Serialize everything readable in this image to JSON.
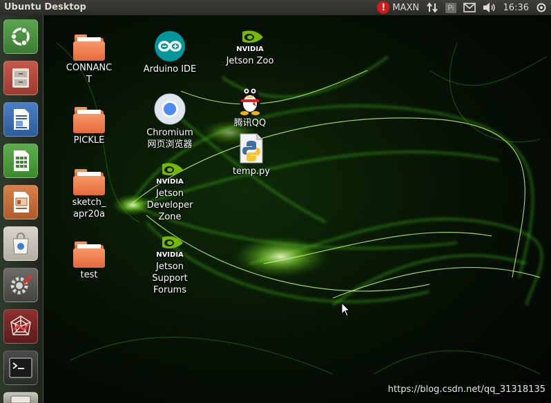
{
  "panel": {
    "title": "Ubuntu Desktop",
    "power_mode": "MAXN",
    "pi_label": "Pi",
    "clock": "16:36"
  },
  "launcher": {
    "items": [
      {
        "name": "dash-home",
        "icon": "ubuntu-logo-icon"
      },
      {
        "name": "files",
        "icon": "file-cabinet-icon"
      },
      {
        "name": "libreoffice-writer",
        "icon": "writer-doc-icon"
      },
      {
        "name": "libreoffice-calc",
        "icon": "calc-spreadsheet-icon"
      },
      {
        "name": "libreoffice-impress",
        "icon": "impress-slides-icon"
      },
      {
        "name": "software-center",
        "icon": "shopping-bag-icon"
      },
      {
        "name": "system-settings",
        "icon": "gear-wrench-icon"
      },
      {
        "name": "web-app",
        "icon": "spider-web-icon"
      },
      {
        "name": "terminal",
        "icon": "terminal-icon"
      },
      {
        "name": "disk",
        "icon": "disk-drive-icon"
      }
    ]
  },
  "desktop": {
    "folders": [
      {
        "label": "CONNANC\nT"
      },
      {
        "label": "PICKLE"
      },
      {
        "label": "sketch_\napr20a"
      },
      {
        "label": "test"
      }
    ],
    "arduino": {
      "label": "Arduino IDE"
    },
    "chromium": {
      "label": "Chromium\n网页浏览器"
    },
    "jetson_dev": {
      "label": "Jetson\nDeveloper\nZone",
      "brand": "NVIDIA"
    },
    "jetson_support": {
      "label": "Jetson\nSupport\nForums",
      "brand": "NVIDIA"
    },
    "jetson_zoo": {
      "label": "Jetson Zoo",
      "brand": "NVIDIA"
    },
    "qq": {
      "label": "腾讯QQ"
    },
    "temp_py": {
      "label": "temp.py"
    }
  },
  "watermark": "https://blog.csdn.net/qq_31318135",
  "colors": {
    "nvidia_green": "#76b900",
    "folder_orange": "#e5693a",
    "panel_bg": "#3c3b37",
    "alert_red": "#d51a1a"
  }
}
